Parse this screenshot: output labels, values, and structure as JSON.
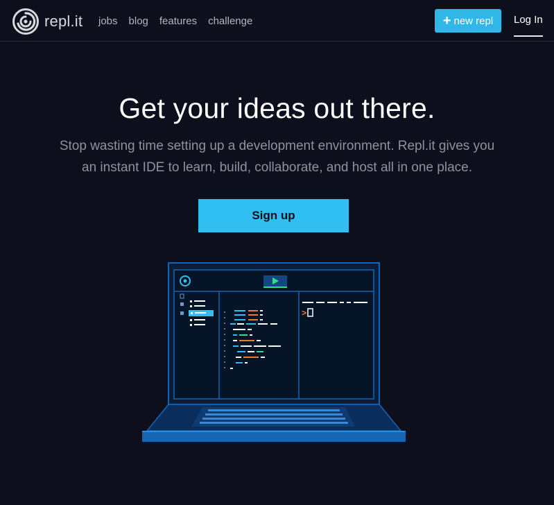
{
  "header": {
    "logo_text": "repl.it",
    "nav": [
      "jobs",
      "blog",
      "features",
      "challenge"
    ],
    "new_repl_label": "new repl",
    "login_label": "Log In"
  },
  "hero": {
    "title": "Get your ideas out there.",
    "subtitle_line1": "Stop wasting time setting up a development environment. Repl.it gives you",
    "subtitle_line2": "an instant IDE to learn, build, collaborate, and host all in one place.",
    "signup_label": "Sign up"
  },
  "colors": {
    "background": "#0e0f1c",
    "accent": "#30bff0",
    "muted_text": "#8f919c",
    "laptop_blue": "#1466b3"
  },
  "illustration": {
    "name": "laptop-ide",
    "terminal_prompt": ">"
  }
}
